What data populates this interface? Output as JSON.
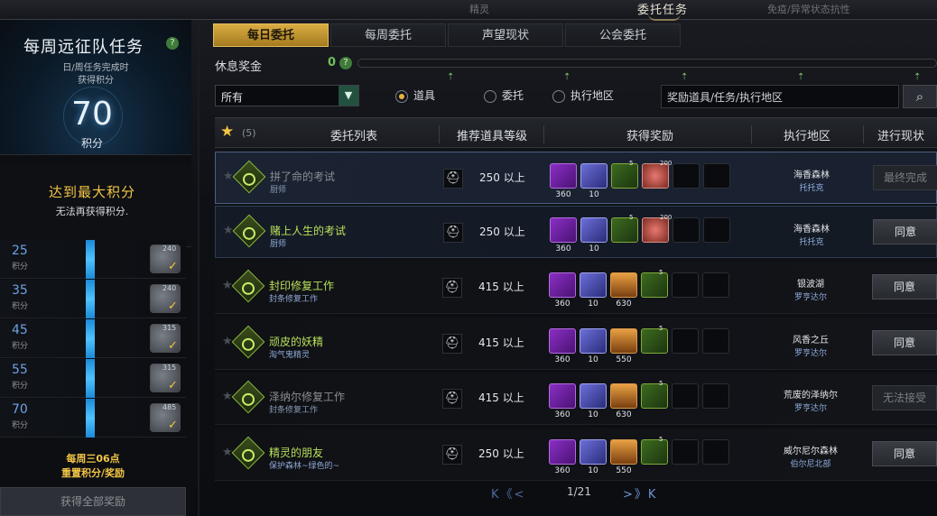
{
  "topbar": {
    "left_tab": "精灵",
    "active_tab": "委托任务",
    "right_tab": "免疫/异常状态抗性"
  },
  "weekly": {
    "title": "每周远征队任务",
    "sub1": "日/周任务完成时",
    "sub2": "获得积分",
    "points": "70",
    "unit": "积分"
  },
  "max": {
    "title": "达到最大积分",
    "desc": "无法再获得积分."
  },
  "tiers": [
    {
      "value": "25",
      "unit": "积分",
      "reward": "240"
    },
    {
      "value": "35",
      "unit": "积分",
      "reward": "240"
    },
    {
      "value": "45",
      "unit": "积分",
      "reward": "315"
    },
    {
      "value": "55",
      "unit": "积分",
      "reward": "315"
    },
    {
      "value": "70",
      "unit": "积分",
      "reward": "485"
    }
  ],
  "reset": {
    "line1": "每周三06点",
    "line2": "重置积分/奖励"
  },
  "getall": "获得全部奖励",
  "tabs": [
    "每日委托",
    "每周委托",
    "声望现状",
    "公会委托"
  ],
  "rest": {
    "label": "休息奖金",
    "value": "0"
  },
  "filter": {
    "select": "所有",
    "radios": [
      "道具",
      "委托",
      "执行地区"
    ],
    "search_placeholder": "奖励道具/任务/执行地区"
  },
  "table": {
    "count": "(5)",
    "headers": [
      "委托列表",
      "推荐道具等级",
      "获得奖励",
      "执行地区",
      "进行现状"
    ]
  },
  "rows": [
    {
      "name": "拼了命的考试",
      "sub": "厨师",
      "level": "250 以上",
      "rewards": [
        {
          "type": "purple",
          "n": "360"
        },
        {
          "type": "gem",
          "n": "10"
        },
        {
          "type": "potion",
          "n": "",
          "s": "5"
        },
        {
          "type": "heart",
          "n": "",
          "s": "200"
        }
      ],
      "loc1": "海香森林",
      "loc2": "托托克",
      "action": "最终完成",
      "state": "dis"
    },
    {
      "name": "赌上人生的考试",
      "sub": "厨师",
      "level": "250 以上",
      "rewards": [
        {
          "type": "purple",
          "n": "360"
        },
        {
          "type": "gem",
          "n": "10"
        },
        {
          "type": "potion",
          "n": "",
          "s": "5"
        },
        {
          "type": "heart",
          "n": "",
          "s": "200"
        }
      ],
      "loc1": "海香森林",
      "loc2": "托托克",
      "action": "同意",
      "state": "on"
    },
    {
      "name": "封印修复工作",
      "sub": "封条修复工作",
      "level": "415 以上",
      "rewards": [
        {
          "type": "purple",
          "n": "360"
        },
        {
          "type": "gem",
          "n": "10"
        },
        {
          "type": "fire",
          "n": "630"
        },
        {
          "type": "potion",
          "n": "",
          "s": "5"
        }
      ],
      "loc1": "银波湖",
      "loc2": "罗亨达尔",
      "action": "同意",
      "state": "on"
    },
    {
      "name": "顽皮的妖精",
      "sub": "淘气鬼精灵",
      "level": "415 以上",
      "rewards": [
        {
          "type": "purple",
          "n": "360"
        },
        {
          "type": "gem",
          "n": "10"
        },
        {
          "type": "fire",
          "n": "550"
        },
        {
          "type": "potion",
          "n": "",
          "s": "5"
        }
      ],
      "loc1": "风香之丘",
      "loc2": "罗亨达尔",
      "action": "同意",
      "state": "on"
    },
    {
      "name": "泽纳尔修复工作",
      "sub": "封条修复工作",
      "level": "415 以上",
      "rewards": [
        {
          "type": "purple",
          "n": "360"
        },
        {
          "type": "gem",
          "n": "10"
        },
        {
          "type": "fire",
          "n": "630"
        },
        {
          "type": "potion",
          "n": "",
          "s": "5"
        }
      ],
      "loc1": "荒废的泽纳尔",
      "loc2": "罗亨达尔",
      "action": "无法接受",
      "state": "dis"
    },
    {
      "name": "精灵的朋友",
      "sub": "保护森林~绿色的~",
      "level": "250 以上",
      "rewards": [
        {
          "type": "purple",
          "n": "360"
        },
        {
          "type": "gem",
          "n": "10"
        },
        {
          "type": "fire",
          "n": "550"
        },
        {
          "type": "potion",
          "n": "",
          "s": "5"
        }
      ],
      "loc1": "威尔尼尔森林",
      "loc2": "伯尔尼北部",
      "action": "同意",
      "state": "on"
    }
  ],
  "pager": {
    "prev": "K《<",
    "page": "1/21",
    "next": ">》K"
  }
}
